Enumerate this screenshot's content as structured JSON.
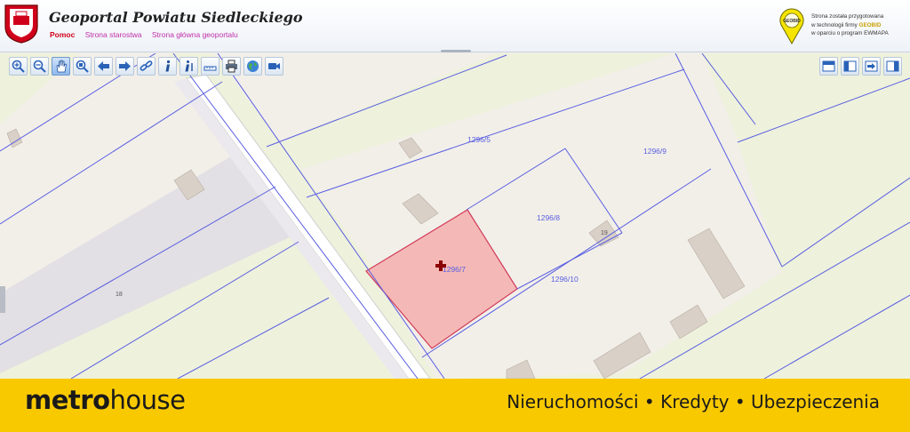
{
  "header": {
    "title": "Geoportal Powiatu Siedleckiego",
    "nav": [
      "Pomoc",
      "Strona starostwa",
      "Strona główna geoportalu"
    ],
    "credit": {
      "line1": "Strona została przygotowana",
      "line2_prefix": "w technologii firmy ",
      "brand": "GEOBID",
      "line3": "w oparciu o program EWMAPA"
    },
    "geobid_badge": "GEOBID"
  },
  "toolbar": {
    "left_tools": [
      "zoom-in-icon",
      "zoom-out-icon",
      "pan-hand-icon",
      "zoom-extent-icon",
      "arrow-back-icon",
      "arrow-forward-icon",
      "link-icon",
      "info-icon",
      "info-query-icon",
      "measure-ruler-icon",
      "print-icon",
      "globe-icon",
      "camera-icon"
    ],
    "active_tool": "pan-hand-icon",
    "right_tools": [
      "layout-top-icon",
      "layout-left-panel-icon",
      "export-icon",
      "layout-right-panel-icon"
    ]
  },
  "map": {
    "parcel_labels": [
      "1296/5",
      "1296/9",
      "1296/8",
      "1296/7",
      "1296/10"
    ],
    "building_numbers": [
      "18",
      "19"
    ],
    "selected_parcel": "1296/7",
    "colors": {
      "grass": "#eef1dc",
      "parcel_fill": "#f2efe9",
      "parcel_line": "#5a5fe0",
      "road": "#ffffff",
      "selected": "#f4b9b6",
      "building": "#d9d0c7",
      "marker": "#8b0000"
    }
  },
  "footer": {
    "logo_metro": "metr",
    "logo_o": "o",
    "logo_house": "house",
    "tagline": "Nieruchomości • Kredyty • Ubezpieczenia",
    "color": "#f9c900"
  }
}
